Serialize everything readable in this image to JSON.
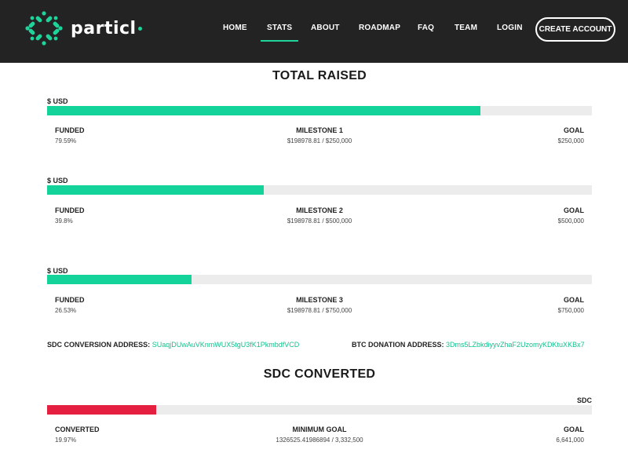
{
  "nav": {
    "brand": "particl",
    "items": [
      "HOME",
      "STATS",
      "ABOUT",
      "ROADMAP",
      "FAQ",
      "TEAM",
      "LOGIN"
    ],
    "active_item": "STATS",
    "cta": "CREATE ACCOUNT"
  },
  "total_raised": {
    "title": "TOTAL RAISED",
    "milestones": [
      {
        "unit": "$ USD",
        "progress_fraction": 0.7959,
        "funded_label": "FUNDED",
        "funded_value": "79.59%",
        "milestone_label": "MILESTONE 1",
        "milestone_value": "$198978.81 / $250,000",
        "goal_label": "GOAL",
        "goal_value": "$250,000"
      },
      {
        "unit": "$ USD",
        "progress_fraction": 0.398,
        "funded_label": "FUNDED",
        "funded_value": "39.8%",
        "milestone_label": "MILESTONE 2",
        "milestone_value": "$198978.81 / $500,000",
        "goal_label": "GOAL",
        "goal_value": "$500,000"
      },
      {
        "unit": "$ USD",
        "progress_fraction": 0.2653,
        "funded_label": "FUNDED",
        "funded_value": "26.53%",
        "milestone_label": "MILESTONE 3",
        "milestone_value": "$198978.81 / $750,000",
        "goal_label": "GOAL",
        "goal_value": "$750,000"
      }
    ]
  },
  "addresses": {
    "sdc_label": "SDC CONVERSION ADDRESS:",
    "sdc_value": "SUaqjDUwAuVKnmWUX5tgU3fK1PkmbdfVCD",
    "btc_label": "BTC DONATION ADDRESS:",
    "btc_value": "3Dms5LZbkdiyyvZhaF2UzomyKDKtuXKBx7"
  },
  "sdc_converted": {
    "title": "SDC CONVERTED",
    "unit": "SDC",
    "progress_fraction": 0.1997,
    "converted_label": "CONVERTED",
    "converted_value": "19.97%",
    "min_goal_label": "MINIMUM GOAL",
    "min_goal_value": "1326525.41986894 / 3,332,500",
    "goal_label": "GOAL",
    "goal_value": "6,641,000"
  },
  "colors": {
    "accent": "#14d39a",
    "danger": "#e41f3f",
    "navbar": "#232323",
    "track": "#ececec"
  }
}
